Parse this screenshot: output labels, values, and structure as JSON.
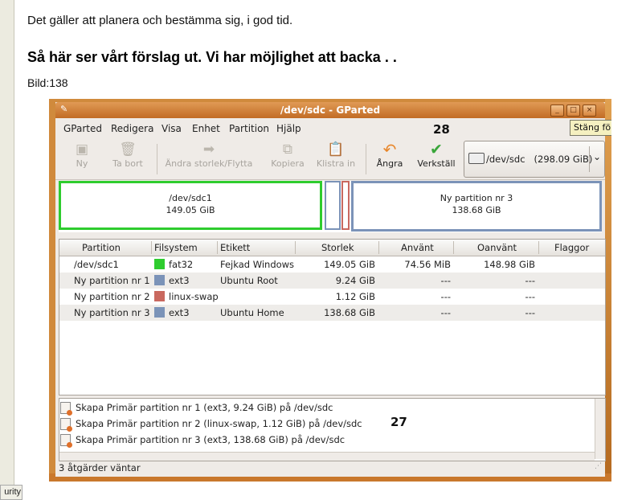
{
  "page": {
    "intro": "Det gäller att planera och bestämma sig, i god tid.",
    "heading": "Så här ser vårt förslag ut. Vi har möjlighet att backa . .",
    "caption": "Bild:138",
    "status_chip": "urity"
  },
  "window": {
    "title": "/dev/sdc - GParted",
    "tooltip": "Stäng fö",
    "annotation_top": "28",
    "annotation_log": "27"
  },
  "menu": [
    "GParted",
    "Redigera",
    "Visa",
    "Enhet",
    "Partition",
    "Hjälp"
  ],
  "toolbar": {
    "new": "Ny",
    "delete": "Ta bort",
    "resize": "Ändra storlek/Flytta",
    "copy": "Kopiera",
    "paste": "Klistra in",
    "undo": "Ångra",
    "apply": "Verkställ",
    "device": "/dev/sdc",
    "device_size": "(298.09 GiB)"
  },
  "diskmap": {
    "p1_name": "/dev/sdc1",
    "p1_size": "149.05 GiB",
    "p4_name": "Ny partition nr 3",
    "p4_size": "138.68 GiB"
  },
  "table": {
    "headers": [
      "Partition",
      "Filsystem",
      "Etikett",
      "Storlek",
      "Använt",
      "Oanvänt",
      "Flaggor"
    ],
    "rows": [
      {
        "partition": "/dev/sdc1",
        "fs": "fat32",
        "label": "Fejkad Windows",
        "size": "149.05 GiB",
        "used": "74.56 MiB",
        "unused": "148.98 GiB",
        "flags": ""
      },
      {
        "partition": "Ny partition nr 1",
        "fs": "ext3",
        "label": "Ubuntu Root",
        "size": "9.24 GiB",
        "used": "---",
        "unused": "---",
        "flags": ""
      },
      {
        "partition": "Ny partition nr 2",
        "fs": "linux-swap",
        "label": "",
        "size": "1.12 GiB",
        "used": "---",
        "unused": "---",
        "flags": ""
      },
      {
        "partition": "Ny partition nr 3",
        "fs": "ext3",
        "label": "Ubuntu Home",
        "size": "138.68 GiB",
        "used": "---",
        "unused": "---",
        "flags": ""
      }
    ]
  },
  "log": [
    "Skapa Primär partition nr 1 (ext3, 9.24 GiB) på /dev/sdc",
    "Skapa Primär partition nr 2 (linux-swap, 1.12 GiB) på /dev/sdc",
    "Skapa Primär partition nr 3 (ext3, 138.68 GiB) på /dev/sdc"
  ],
  "status": "3 åtgärder väntar",
  "colors": {
    "fat32": "#2ecc2e",
    "ext3": "#7b93b8",
    "linux-swap": "#c9685f",
    "title_orange": "#d27a30"
  }
}
